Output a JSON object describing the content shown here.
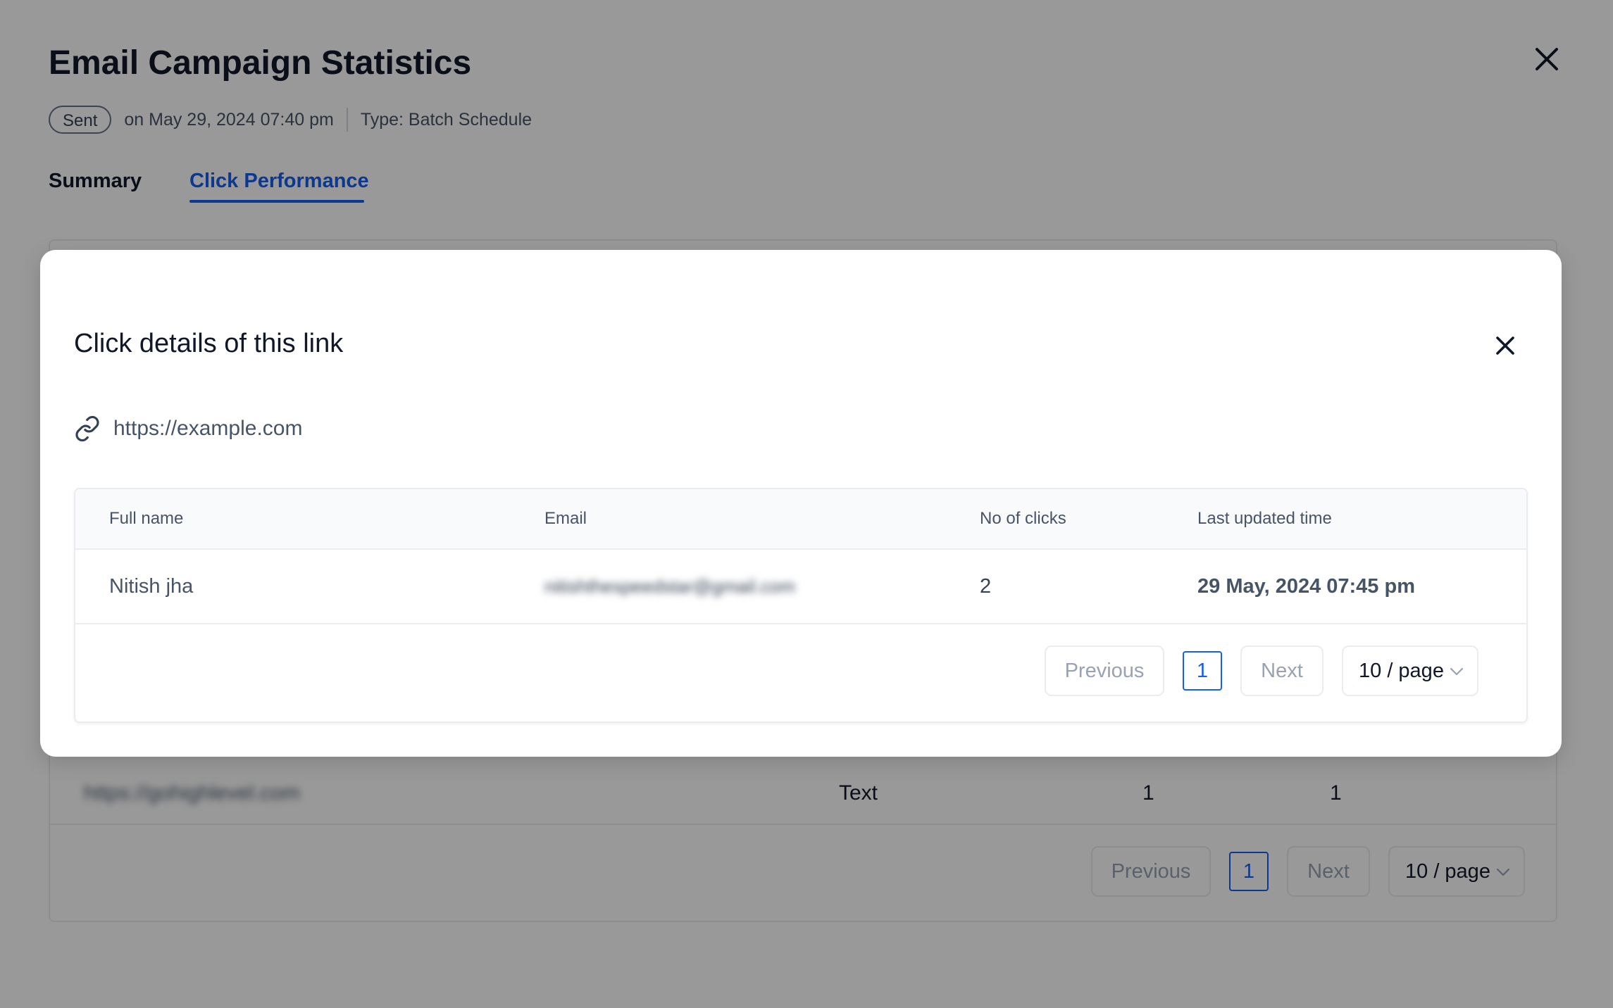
{
  "drawer": {
    "title": "Email Campaign Statistics",
    "status_badge": "Sent",
    "sent_on": "on May 29, 2024 07:40 pm",
    "type": "Type: Batch Schedule",
    "tabs": [
      {
        "label": "Summary",
        "active": false
      },
      {
        "label": "Click Performance",
        "active": true
      }
    ],
    "table": {
      "row": {
        "url": "https://gohighlevel.com",
        "type": "Text",
        "col3": "1",
        "col4": "1"
      },
      "pagination": {
        "previous": "Previous",
        "page": "1",
        "next": "Next",
        "page_size": "10 / page"
      }
    }
  },
  "modal": {
    "title": "Click details of this link",
    "link": "https://example.com",
    "table": {
      "headers": [
        "Full name",
        "Email",
        "No of clicks",
        "Last updated time"
      ],
      "rows": [
        {
          "full_name": "Nitish jha",
          "email": "nitishthespeedstar@gmail.com",
          "clicks": "2",
          "last_updated": "29 May, 2024 07:45 pm"
        }
      ],
      "pagination": {
        "previous": "Previous",
        "page": "1",
        "next": "Next",
        "page_size": "10 / page"
      }
    }
  },
  "colors": {
    "accent": "#155eef",
    "text_primary": "#101828",
    "text_secondary": "#475467",
    "border": "#eaecf0",
    "overlay": "rgba(0,0,0,0.40)"
  },
  "icons": {
    "drawer_close": "close-icon",
    "modal_close": "close-icon",
    "link": "link-icon",
    "page_size": "chevron-down-icon"
  }
}
